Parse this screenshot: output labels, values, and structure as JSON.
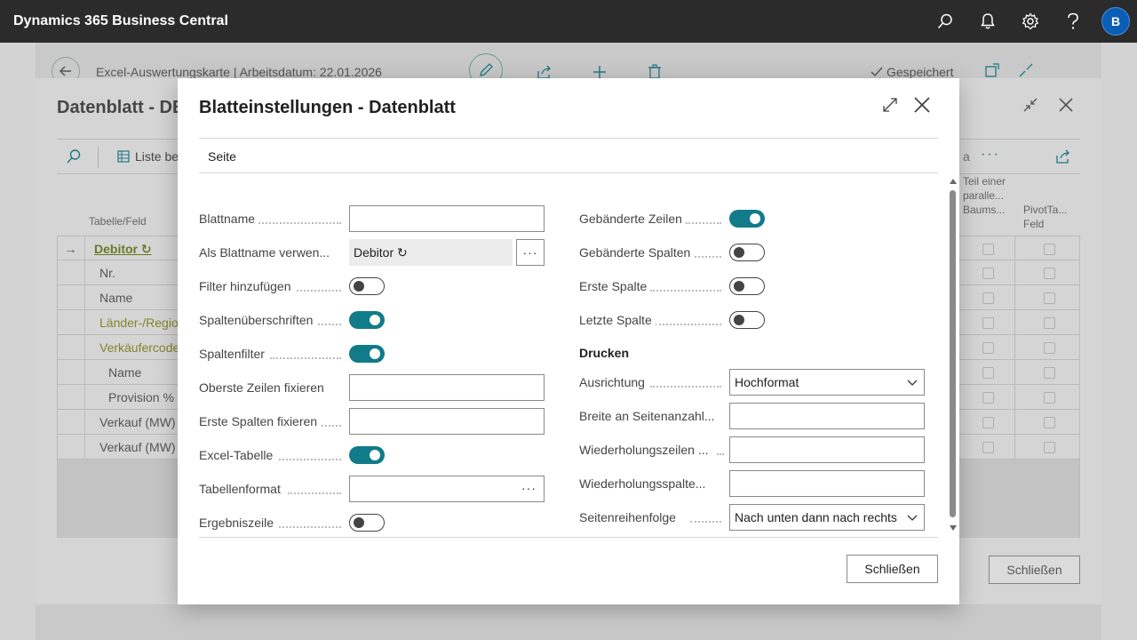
{
  "topbar": {
    "app_title": "Dynamics 365 Business Central",
    "avatar_initial": "B"
  },
  "card": {
    "title": "Excel-Auswertungskarte | Arbeitsdatum: 22.01.2026",
    "saved_label": "Gespeichert"
  },
  "panel": {
    "title": "Datenblatt - DE",
    "toolbar_list_label": "Liste be",
    "toolbar_a": "a",
    "column_header_left": "Tabelle/Feld",
    "column_header_r1": "Teil einer paralle... Baums...",
    "column_header_r2": "PivotTa... Feld",
    "rows": [
      {
        "text": "Debitor ↻",
        "style": "link",
        "indent": 0,
        "arrow": "→"
      },
      {
        "text": "Nr.",
        "style": "plain",
        "indent": 1,
        "arrow": ""
      },
      {
        "text": "Name",
        "style": "plain",
        "indent": 1,
        "arrow": ""
      },
      {
        "text": "Länder-/Regio",
        "style": "olive",
        "indent": 1,
        "arrow": ""
      },
      {
        "text": "Verkäufercode",
        "style": "olive",
        "indent": 1,
        "arrow": ""
      },
      {
        "text": "Name",
        "style": "plain",
        "indent": 2,
        "arrow": ""
      },
      {
        "text": "Provision %",
        "style": "plain",
        "indent": 2,
        "arrow": ""
      },
      {
        "text": "Verkauf (MW)",
        "style": "plain",
        "indent": 1,
        "arrow": ""
      },
      {
        "text": "Verkauf (MW)",
        "style": "plain",
        "indent": 1,
        "arrow": ""
      }
    ],
    "close_label": "Schließen"
  },
  "modal": {
    "title": "Blatteinstellungen - Datenblatt",
    "tab_label": "Seite",
    "left_fields": {
      "blattname": {
        "label": "Blattname",
        "value": ""
      },
      "als_blattname": {
        "label": "Als Blattname verwen...",
        "value": "Debitor ↻"
      },
      "filter": {
        "label": "Filter hinzufügen",
        "on": false
      },
      "spaltenueberschriften": {
        "label": "Spaltenüberschriften",
        "on": true
      },
      "spaltenfilter": {
        "label": "Spaltenfilter",
        "on": true
      },
      "oberste_zeilen": {
        "label": "Oberste Zeilen fixieren",
        "value": ""
      },
      "erste_spalten": {
        "label": "Erste Spalten fixieren",
        "value": ""
      },
      "excel_tabelle": {
        "label": "Excel-Tabelle",
        "on": true
      },
      "tabellenformat": {
        "label": "Tabellenformat",
        "value": ""
      },
      "ergebniszeile": {
        "label": "Ergebniszeile",
        "on": false
      }
    },
    "right_fields": {
      "gebaenderte_zeilen": {
        "label": "Gebänderte Zeilen",
        "on": true
      },
      "gebaenderte_spalten": {
        "label": "Gebänderte Spalten",
        "on": false
      },
      "erste_spalte": {
        "label": "Erste Spalte",
        "on": false
      },
      "letzte_spalte": {
        "label": "Letzte Spalte",
        "on": false
      },
      "drucken_heading": "Drucken",
      "ausrichtung": {
        "label": "Ausrichtung",
        "value": "Hochformat"
      },
      "breite": {
        "label": "Breite an Seitenanzahl...",
        "value": ""
      },
      "wiederholungszeilen": {
        "label": "Wiederholungszeilen ...",
        "value": ""
      },
      "wiederholungsspalten": {
        "label": "Wiederholungsspalte...",
        "value": ""
      },
      "seitenreihenfolge": {
        "label": "Seitenreihenfolge",
        "value": "Nach unten dann nach rechts"
      }
    },
    "close_label": "Schließen"
  },
  "colors": {
    "topbar": "#2b2b2b",
    "accent_toggle": "#117b8a",
    "avatar": "#0a5eb5",
    "link_olive": "#6b7f1f"
  }
}
